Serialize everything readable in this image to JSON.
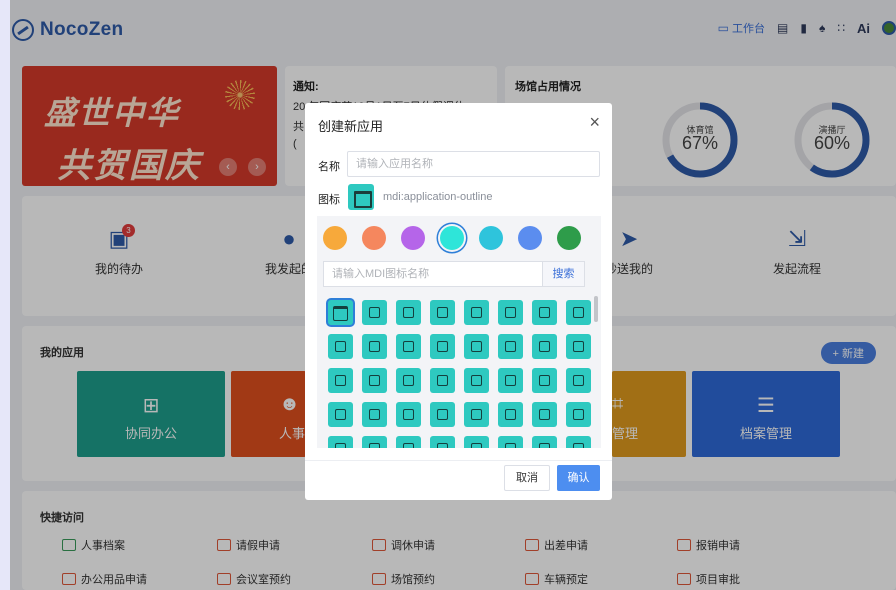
{
  "header": {
    "logo_text": "NocoZen",
    "workbench_label": "工作台",
    "ai_label": "Ai"
  },
  "banner": {
    "line1": "盛世中华",
    "line2": "共贺国庆"
  },
  "notice": {
    "title": "通知:",
    "line1": "20 年国庆节10月1日至7日休假调休",
    "line2": "共",
    "line3": "("
  },
  "venue": {
    "title": "场馆占用情况",
    "gauges": [
      {
        "label": "体育馆",
        "value": 67,
        "display": "67%"
      },
      {
        "label": "演播厅",
        "value": 60,
        "display": "60%"
      }
    ]
  },
  "quick_actions": [
    {
      "label": "我的待办",
      "badge": "3"
    },
    {
      "label": "我发起的"
    },
    {
      "label": "抄送我的"
    },
    {
      "label": "发起流程"
    }
  ],
  "apps": {
    "title": "我的应用",
    "new_label": "+ 新建",
    "tiles": [
      {
        "label": "协同办公",
        "color": "#1e9e8c"
      },
      {
        "label": "人事",
        "color": "#e0501e"
      },
      {
        "label": "管理",
        "color": "#e09a1e"
      },
      {
        "label": "档案管理",
        "color": "#2e6ad8"
      }
    ]
  },
  "shortcuts": {
    "title": "快捷访问",
    "items": [
      "人事档案",
      "请假申请",
      "调休申请",
      "出差申请",
      "报销申请",
      "办公用品申请",
      "会议室预约",
      "场馆预约",
      "车辆预定",
      "项目审批"
    ]
  },
  "modal": {
    "title": "创建新应用",
    "close": "×",
    "name_label": "名称",
    "name_placeholder": "请输入应用名称",
    "icon_label": "图标",
    "icon_value": "mdi:application-outline",
    "colors": [
      "#f7a93b",
      "#f5875e",
      "#b565e9",
      "#2ee5d9",
      "#2ec4dc",
      "#5b8def",
      "#2e9c4a"
    ],
    "selected_color_index": 3,
    "search_placeholder": "请输入MDI图标名称",
    "search_button": "搜索",
    "icon_count": 40,
    "selected_icon_index": 0,
    "cancel": "取消",
    "confirm": "确认"
  }
}
